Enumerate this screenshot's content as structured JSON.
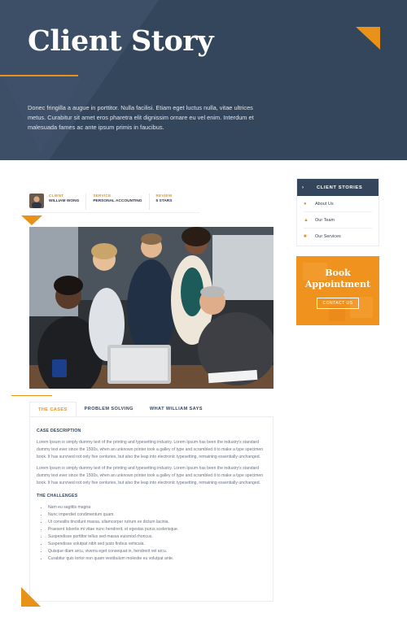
{
  "hero": {
    "title": "Client Story",
    "text": "Donec fringilla a augue in porttitor. Nulla facilisi. Etiam eget luctus nulla, vitae ultrices metus. Curabitur sit amet eros pharetra elit dignissim ornare eu vel enim. Interdum et malesuada fames ac ante ipsum primis in faucibus."
  },
  "meta": {
    "client_label": "CLIENT",
    "client_value": "WILLIAM WONG",
    "service_label": "SERVICE",
    "service_value": "PERSONAL ACCOUNTING",
    "review_label": "REVIEW",
    "review_value": "5 STARS"
  },
  "tabs": [
    {
      "label": "THE CASES",
      "active": true
    },
    {
      "label": "PROBLEM SOLVING",
      "active": false
    },
    {
      "label": "WHAT WILLIAM SAYS",
      "active": false
    }
  ],
  "content": {
    "heading1": "CASE DESCRIPTION",
    "para1": "Lorem Ipsum is simply dummy text of the printing and typesetting industry. Lorem Ipsum has been the industry's standard dummy text ever since the 1500s, when an unknown printer took a galley of type and scrambled it to make a type specimen book. It has survived not only five centuries, but also the leap into electronic typesetting, remaining essentially unchanged.",
    "para2": "Lorem Ipsum is simply dummy text of the printing and typesetting industry. Lorem Ipsum has been the industry's standard dummy text ever since the 1500s, when an unknown printer took a galley of type and scrambled it to make a type specimen book. It has survived not only five centuries, but also the leap into electronic typesetting, remaining essentially unchanged.",
    "heading2": "THE CHALLENGES",
    "challenges": [
      "Nam eu sagittis magna",
      "Nunc imperdiet condimentum quam.",
      "Ut convallis tincidunt massa, ullamcorper rutrum ex dictum lacinia.",
      "Praesent lobortis mi vitae nunc hendrerit, et egestas purus scelerisque.",
      "Suspendisse porttitor tellus sed massa euismod rhoncus.",
      "Suspendisse volutpat nibh sed justo finibus vehicula.",
      "Quisque diam arcu, viverra eget consequat in, hendrerit vel arcu.",
      "Curabitur quis tortor non quam vestibulum molestie eu volutpat ante."
    ]
  },
  "sidebar": {
    "title": "CLIENT STORIES",
    "items": [
      {
        "label": "About Us",
        "icon": "people-icon"
      },
      {
        "label": "Our Team",
        "icon": "person-icon"
      },
      {
        "label": "Our Services",
        "icon": "folder-icon"
      }
    ]
  },
  "book": {
    "title_line1": "Book",
    "title_line2": "Appointment",
    "button": "CONTACT US"
  },
  "colors": {
    "navy": "#34465c",
    "accent": "#f0921e"
  }
}
